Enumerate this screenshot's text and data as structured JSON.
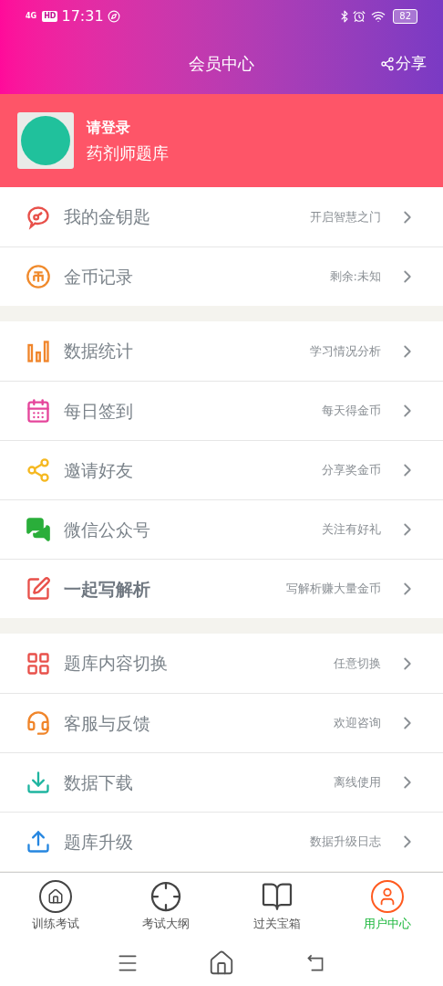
{
  "status_bar": {
    "network": "4G",
    "hd": "HD",
    "time": "17:31",
    "battery": "82"
  },
  "header": {
    "title": "会员中心",
    "share": "分享"
  },
  "profile": {
    "login": "请登录",
    "name": "药剂师题库"
  },
  "groups": [
    [
      {
        "kind": "key",
        "color": "#e8504a",
        "label": "我的金钥匙",
        "hint": "开启智慧之门",
        "bold": false
      },
      {
        "kind": "coin",
        "color": "#f08a2c",
        "label": "金币记录",
        "hint": "剩余:未知",
        "bold": false
      }
    ],
    [
      {
        "kind": "stats",
        "color": "#f0852a",
        "label": "数据统计",
        "hint": "学习情况分析",
        "bold": false
      },
      {
        "kind": "calendar",
        "color": "#e5459b",
        "label": "每日签到",
        "hint": "每天得金币",
        "bold": false
      },
      {
        "kind": "share",
        "color": "#f5b820",
        "label": "邀请好友",
        "hint": "分享奖金币",
        "bold": false
      },
      {
        "kind": "chat",
        "color": "#2aae3a",
        "label": "微信公众号",
        "hint": "关注有好礼",
        "bold": false
      },
      {
        "kind": "edit",
        "color": "#e8504a",
        "label": "一起写解析",
        "hint": "写解析赚大量金币",
        "bold": true
      }
    ],
    [
      {
        "kind": "grid",
        "color": "#e8504a",
        "label": "题库内容切换",
        "hint": "任意切换",
        "bold": false
      },
      {
        "kind": "headset",
        "color": "#f0852a",
        "label": "客服与反馈",
        "hint": "欢迎咨询",
        "bold": false
      },
      {
        "kind": "download",
        "color": "#1fb5a0",
        "label": "数据下载",
        "hint": "离线使用",
        "bold": false
      },
      {
        "kind": "upload",
        "color": "#2586e0",
        "label": "题库升级",
        "hint": "数据升级日志",
        "bold": false
      }
    ]
  ],
  "tabs": [
    {
      "kind": "home",
      "label": "训练考试",
      "selected": false
    },
    {
      "kind": "target",
      "label": "考试大纲",
      "selected": false
    },
    {
      "kind": "book",
      "label": "过关宝箱",
      "selected": false
    },
    {
      "kind": "user",
      "label": "用户中心",
      "selected": true
    }
  ]
}
